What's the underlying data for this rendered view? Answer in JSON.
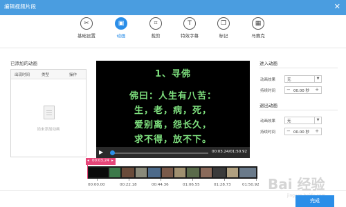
{
  "window": {
    "title": "编辑视频片段",
    "close_glyph": "✕"
  },
  "toolbar": {
    "items": [
      {
        "label": "基础设置",
        "icon": "scissors-icon",
        "glyph": "✂"
      },
      {
        "label": "动画",
        "icon": "animation-icon",
        "glyph": "▣",
        "active": true
      },
      {
        "label": "裁剪",
        "icon": "crop-icon",
        "glyph": "⌗"
      },
      {
        "label": "特效字幕",
        "icon": "text-icon",
        "glyph": "T"
      },
      {
        "label": "标记",
        "icon": "bookmark-icon",
        "glyph": "❐"
      },
      {
        "label": "马赛克",
        "icon": "mosaic-icon",
        "glyph": "▦"
      }
    ]
  },
  "left": {
    "title": "已添加的动画",
    "columns": [
      "出现时间",
      "类型",
      "操作"
    ],
    "empty_text": "尚未添加动画"
  },
  "video": {
    "lines": [
      "1、寻佛",
      "佛曰：人生有八苦：",
      "生，老，病，死，",
      "爱别离，怨长久，",
      "求不得，放不下。"
    ],
    "text_color": "#7ee07e",
    "time": "00:03.24/01:50.92"
  },
  "enter_anim": {
    "title": "进入动画",
    "effect_label": "动画效果",
    "effect_value": "无",
    "duration_label": "持续时间",
    "duration_value": "00.00 秒"
  },
  "exit_anim": {
    "title": "退出动画",
    "effect_label": "动画效果",
    "effect_value": "无",
    "duration_label": "持续时间",
    "duration_value": "00.00 秒"
  },
  "timeline": {
    "marker": "00:03.24",
    "marker_color": "#e64679",
    "ticks": [
      "00:00.00",
      "00:22.18",
      "00:44.36",
      "01:06.55",
      "01:28.73",
      "01:50.92"
    ]
  },
  "footer": {
    "done_label": "完成"
  },
  "watermark": {
    "text": "Bai 经验",
    "sub": "jingyan.baidu.com"
  },
  "colors": {
    "accent": "#2b8ee8",
    "titlebar": "#4a9de0"
  }
}
